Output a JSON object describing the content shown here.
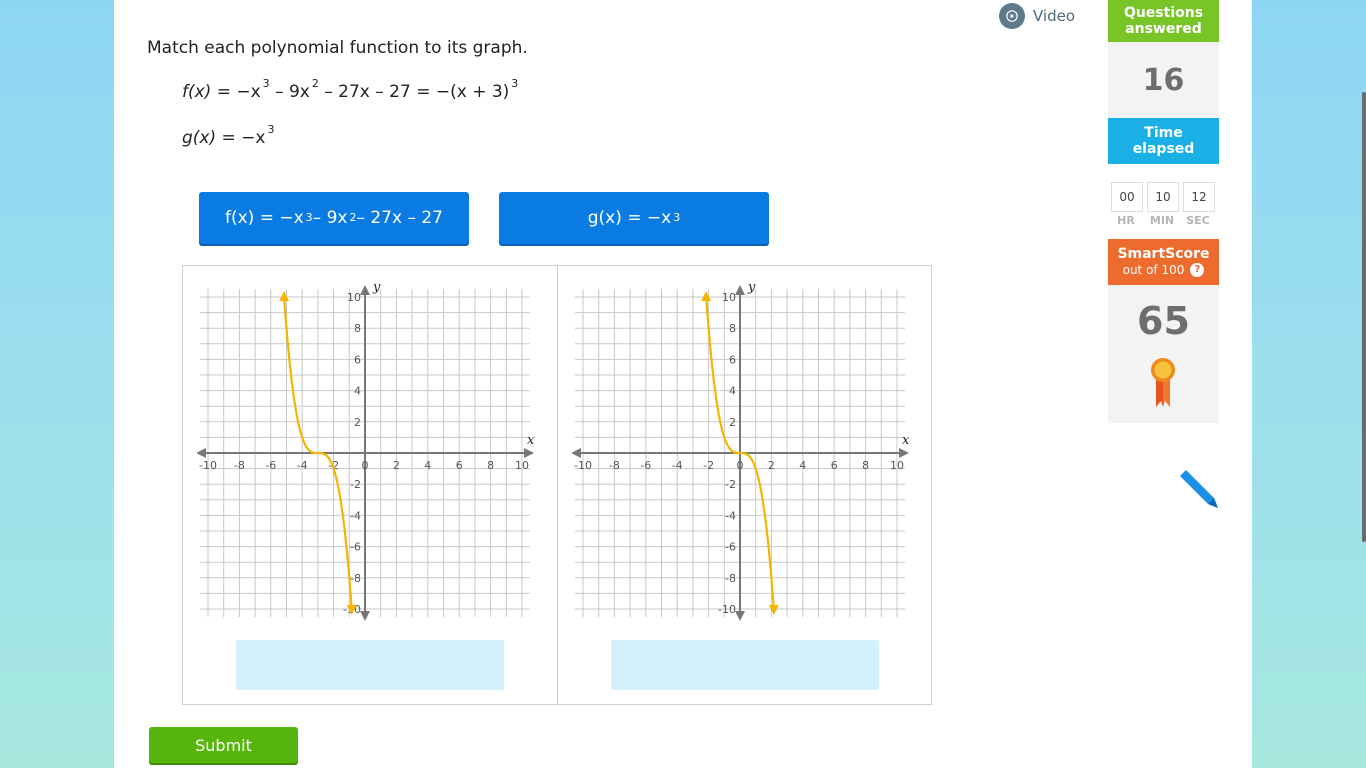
{
  "video": {
    "label": "Video"
  },
  "question": {
    "prompt": "Match each polynomial function to its graph.",
    "f_expr": {
      "name": "f(x)",
      "text_a": "= −x",
      "sup1": "3",
      "text_b": "– 9x",
      "sup2": "2",
      "text_c": "– 27x – 27 = −(x + 3)",
      "sup3": "3"
    },
    "g_expr": {
      "name": "g(x)",
      "text_a": "= −x",
      "sup1": "3"
    }
  },
  "tiles": [
    {
      "label_a": "f(x) = −x",
      "sup1": "3",
      "label_b": " – 9x",
      "sup2": "2",
      "label_c": " – 27x – 27"
    },
    {
      "label_a": "g(x) = −x",
      "sup1": "3"
    }
  ],
  "graph": {
    "x_axis_label": "x",
    "y_axis_label": "y",
    "x_ticks": [
      "-10",
      "-8",
      "-6",
      "-4",
      "-2",
      "0",
      "2",
      "4",
      "6",
      "8",
      "10"
    ],
    "y_ticks": [
      "10",
      "8",
      "6",
      "4",
      "2",
      "-2",
      "-4",
      "-6",
      "-8",
      "-10"
    ],
    "curve_color": "#f5b400"
  },
  "chart_data": [
    {
      "type": "line",
      "title": "",
      "xlabel": "x",
      "ylabel": "y",
      "xlim": [
        -10,
        10
      ],
      "ylim": [
        -10,
        10
      ],
      "grid": true,
      "series": [
        {
          "shift": -3,
          "x": [
            -5.15,
            -5,
            -4.5,
            -4,
            -3.5,
            -3,
            -2.5,
            -2,
            -1.5,
            -1,
            -0.85
          ],
          "y": [
            10,
            8,
            3.38,
            1,
            0.13,
            0,
            -0.13,
            -1,
            -3.38,
            -8,
            -10
          ]
        }
      ]
    },
    {
      "type": "line",
      "title": "",
      "xlabel": "x",
      "ylabel": "y",
      "xlim": [
        -10,
        10
      ],
      "ylim": [
        -10,
        10
      ],
      "grid": true,
      "series": [
        {
          "shift": 0,
          "x": [
            -2.15,
            -2,
            -1.5,
            -1,
            -0.5,
            0,
            0.5,
            1,
            1.5,
            2,
            2.15
          ],
          "y": [
            10,
            8,
            3.38,
            1,
            0.13,
            0,
            -0.13,
            -1,
            -3.38,
            -8,
            -10
          ]
        }
      ]
    }
  ],
  "submit": {
    "label": "Submit"
  },
  "sidebar": {
    "questions_answered_label_1": "Questions",
    "questions_answered_label_2": "answered",
    "questions_answered_value": "16",
    "time_label_1": "Time",
    "time_label_2": "elapsed",
    "time": {
      "hr": "00",
      "min": "10",
      "sec": "12"
    },
    "time_units": {
      "hr": "HR",
      "min": "MIN",
      "sec": "SEC"
    },
    "smartscore_label": "SmartScore",
    "smartscore_sub": "out of 100",
    "smartscore_help": "?",
    "smartscore_value": "65"
  },
  "icons": [
    "play-icon",
    "help-icon",
    "ribbon-icon",
    "pencil-icon"
  ]
}
